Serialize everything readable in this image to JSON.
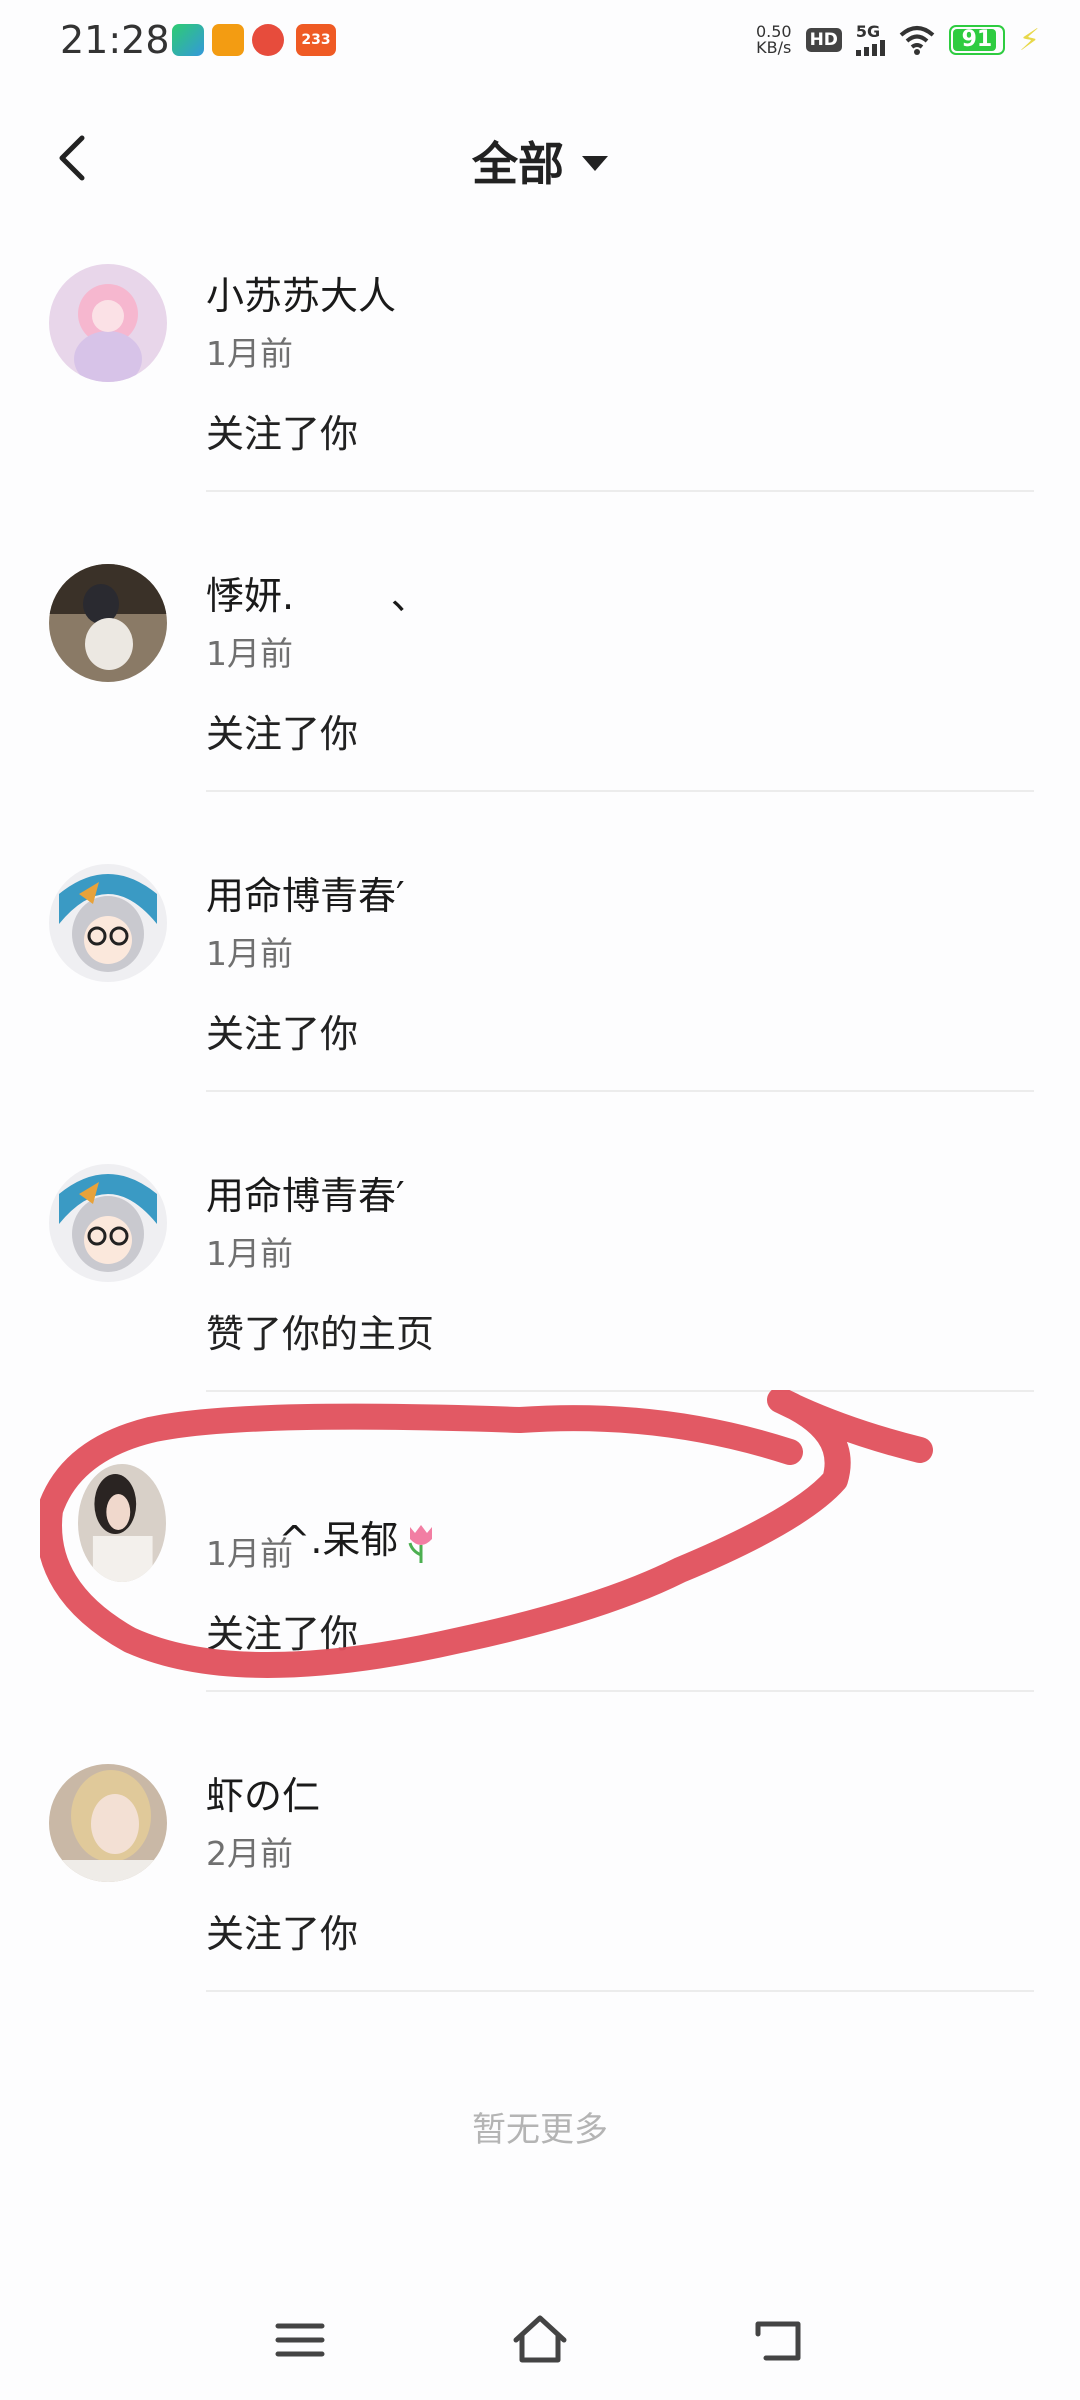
{
  "status_bar": {
    "time": "21:28",
    "net_speed_value": "0.50",
    "net_speed_unit": "KB/s",
    "hd": "HD",
    "network": "5G",
    "battery": "91",
    "app_icons": [
      "video-app-icon",
      "player-app-icon",
      "live-app-icon",
      "233-app-icon"
    ],
    "app_233_label": "233"
  },
  "header": {
    "title": "全部",
    "back_icon": "chevron-left-icon",
    "dropdown_icon": "caret-down-icon"
  },
  "notifications": [
    {
      "name": "小苏苏大人",
      "time": "1月前",
      "action": "关注了你",
      "avatar": "anime-girl-pink-avatar"
    },
    {
      "name": "悸妍.        、",
      "time": "1月前",
      "action": "关注了你",
      "avatar": "cosplay-photo-avatar"
    },
    {
      "name": "用命博青春′",
      "time": "1月前",
      "action": "关注了你",
      "avatar": "cartoon-glasses-avatar"
    },
    {
      "name": "用命博青春′",
      "time": "1月前",
      "action": "赞了你的主页",
      "avatar": "cartoon-glasses-avatar"
    },
    {
      "name": "^.呆郁",
      "time": "1月前",
      "action": "关注了你",
      "avatar": "girl-photo-avatar",
      "emoji": "tulip-icon"
    },
    {
      "name": "虾の仁",
      "time": "2月前",
      "action": "关注了你",
      "avatar": "blonde-girl-avatar"
    }
  ],
  "footer": {
    "no_more": "暂无更多"
  },
  "nav_bar": {
    "menu_icon": "menu-icon",
    "home_icon": "home-icon",
    "back_icon": "return-icon"
  },
  "colors": {
    "highlight_stroke": "#e0505c",
    "battery": "#2ecc40",
    "secondary_text": "#707070",
    "no_more_text": "#b4b4b4"
  }
}
